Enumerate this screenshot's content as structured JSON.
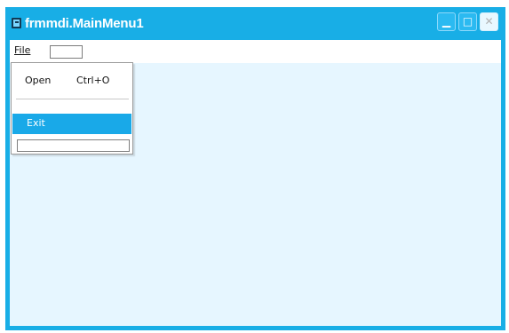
{
  "window": {
    "title": "frmmdi.MainMenu1"
  },
  "window_buttons": {
    "minimize": "▁",
    "maximize": "□",
    "close": "✕"
  },
  "menubar": {
    "file_label": "File"
  },
  "dropdown": {
    "open_label": "Open",
    "open_shortcut": "Ctrl+O",
    "exit_label": "Exit"
  },
  "icons": {
    "app": "form-app-icon"
  },
  "colors": {
    "titlebar": "#18aee6",
    "client": "#e6f6ff",
    "selection": "#19a9e8"
  }
}
